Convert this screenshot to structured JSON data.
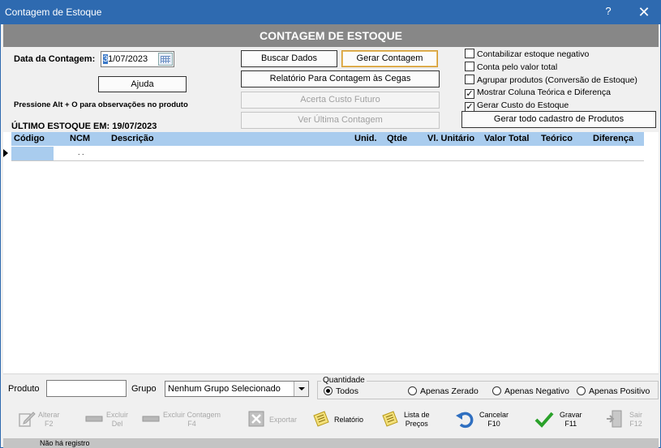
{
  "window": {
    "title": "Contagem de Estoque",
    "help": "?",
    "close": "✕"
  },
  "header": {
    "title": "CONTAGEM DE ESTOQUE"
  },
  "form": {
    "date_label": "Data da Contagem:",
    "date_cursor": "3",
    "date_rest": "1/07/2023",
    "help_button": "Ajuda",
    "hint": "Pressione Alt + O para observações no produto",
    "last_stock": "ÚLTIMO ESTOQUE EM: 19/07/2023"
  },
  "actions": {
    "buscar": "Buscar Dados",
    "gerar": "Gerar Contagem",
    "relatorio_cegas": "Relatório Para Contagem às Cegas",
    "acerta_custo": "Acerta Custo Futuro",
    "ver_ultima": "Ver Última Contagem",
    "gerar_cadastro": "Gerar todo cadastro de Produtos"
  },
  "options": [
    {
      "label": "Contabilizar estoque negativo",
      "checked": false
    },
    {
      "label": "Conta pelo valor total",
      "checked": false
    },
    {
      "label": "Agrupar produtos (Conversão de Estoque)",
      "checked": false
    },
    {
      "label": "Mostrar Coluna Teórica e Diferença",
      "checked": true
    },
    {
      "label": "Gerar Custo do Estoque",
      "checked": true
    }
  ],
  "grid": {
    "columns": [
      "Código",
      "NCM",
      "Descrição",
      "Unid.",
      "Qtde",
      "Vl. Unitário",
      "Valor Total",
      "Teórico",
      "Diferença"
    ],
    "row_ncm": ". ."
  },
  "filters": {
    "produto_label": "Produto",
    "grupo_label": "Grupo",
    "grupo_value": "Nenhum Grupo Selecionado",
    "quantidade_legend": "Quantidade",
    "radios": [
      {
        "label": "Todos",
        "checked": true
      },
      {
        "label": "Apenas Zerado",
        "checked": false
      },
      {
        "label": "Apenas Negativo",
        "checked": false
      },
      {
        "label": "Apenas Positivo",
        "checked": false
      }
    ]
  },
  "toolbar": {
    "alterar": "Alterar",
    "alterar_key": "F2",
    "excluir": "Excluir",
    "excluir_key": "Del",
    "excluir_contagem": "Excluir Contagem",
    "excluir_contagem_key": "F4",
    "exportar": "Exportar",
    "relatorio": "Relatório",
    "lista_precos_1": "Lista de",
    "lista_precos_2": "Preços",
    "cancelar": "Cancelar",
    "cancelar_key": "F10",
    "gravar": "Gravar",
    "gravar_key": "F11",
    "sair": "Sair",
    "sair_key": "F12"
  },
  "status": {
    "text": "Não há registro"
  },
  "colors": {
    "title_bar": "#2e6ab0",
    "header_band": "#878787",
    "grid_header": "#a9ccee",
    "gravar_check": "#2aa12a"
  }
}
